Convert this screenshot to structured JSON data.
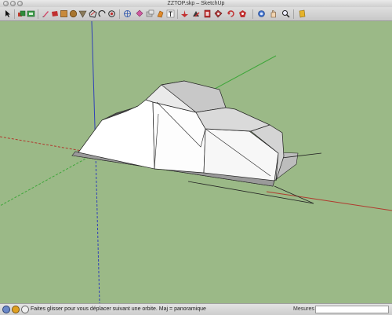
{
  "window": {
    "title": "ZZTOP.skp – SketchUp"
  },
  "toolbar": {
    "tools": [
      "select-arrow-icon",
      "make-component-icon",
      "component-browser-icon",
      "eraser-icon",
      "paint-bucket-icon",
      "rectangle-icon",
      "circle-icon",
      "push-pull-icon",
      "arc-icon",
      "follow-me-icon",
      "rotate-icon",
      "offset-icon",
      "move-icon",
      "scale-icon",
      "tape-measure-icon",
      "text-icon",
      "protractor-icon",
      "orbit-icon",
      "pan-icon",
      "zoom-icon",
      "zoom-window-icon",
      "zoom-extents-icon",
      "warehouse-icon"
    ]
  },
  "status": {
    "message": "Faites glisser pour vous déplacer suivant une orbite.  Maj = panoramique",
    "mesures_label": "Mesures",
    "mesures_value": ""
  },
  "colors": {
    "ground": "#9bb987",
    "axis_red": "#b03a2e",
    "axis_green": "#3ea63a",
    "axis_blue": "#3040b8"
  }
}
